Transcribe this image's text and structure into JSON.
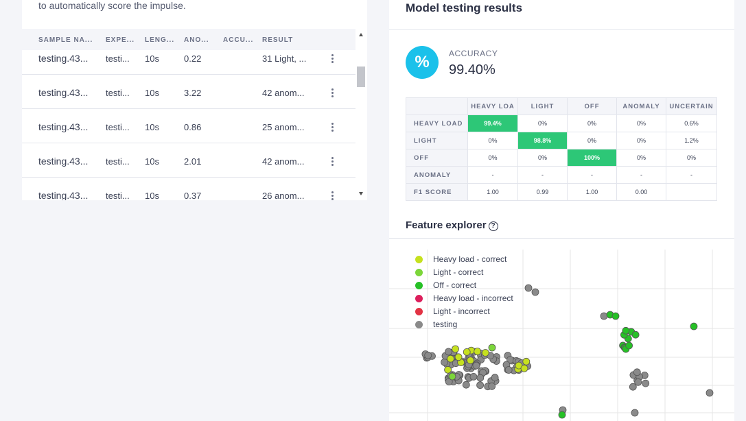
{
  "intro_text": "to automatically score the impulse.",
  "table": {
    "columns": [
      "SAMPLE NA...",
      "EXPE...",
      "LENG...",
      "ANO...",
      "ACCU...",
      "RESULT"
    ],
    "rows": [
      {
        "name": "testing.43...",
        "expected": "testi...",
        "length": "10s",
        "anomaly": "0.22",
        "accuracy": "",
        "result": "31 Light, ..."
      },
      {
        "name": "testing.43...",
        "expected": "testi...",
        "length": "10s",
        "anomaly": "3.22",
        "accuracy": "",
        "result": "42 anom..."
      },
      {
        "name": "testing.43...",
        "expected": "testi...",
        "length": "10s",
        "anomaly": "0.86",
        "accuracy": "",
        "result": "25 anom..."
      },
      {
        "name": "testing.43...",
        "expected": "testi...",
        "length": "10s",
        "anomaly": "2.01",
        "accuracy": "",
        "result": "42 anom..."
      },
      {
        "name": "testing.43...",
        "expected": "testi...",
        "length": "10s",
        "anomaly": "0.37",
        "accuracy": "",
        "result": "26 anom..."
      }
    ]
  },
  "results": {
    "title": "Model testing results",
    "accuracy_icon": "percent-icon",
    "accuracy_label": "ACCURACY",
    "accuracy_value": "99.40%",
    "matrix": {
      "columns": [
        "HEAVY LOA",
        "LIGHT",
        "OFF",
        "ANOMALY",
        "UNCERTAIN"
      ],
      "rows": [
        {
          "label": "HEAVY LOAD",
          "cells": [
            "99.4%",
            "0%",
            "0%",
            "0%",
            "0.6%"
          ],
          "highlight": 0
        },
        {
          "label": "LIGHT",
          "cells": [
            "0%",
            "98.8%",
            "0%",
            "0%",
            "1.2%"
          ],
          "highlight": 1
        },
        {
          "label": "OFF",
          "cells": [
            "0%",
            "0%",
            "100%",
            "0%",
            "0%"
          ],
          "highlight": 2
        },
        {
          "label": "ANOMALY",
          "cells": [
            "-",
            "-",
            "-",
            "-",
            "-"
          ],
          "highlight": -1
        },
        {
          "label": "F1 SCORE",
          "cells": [
            "1.00",
            "0.99",
            "1.00",
            "0.00",
            ""
          ],
          "highlight": -1
        }
      ],
      "highlight_color": "#2dc777"
    }
  },
  "feature_explorer": {
    "title": "Feature explorer",
    "help_icon": "question-circle-icon",
    "legend": [
      {
        "label": "Heavy load - correct",
        "color": "#c6e11f"
      },
      {
        "label": "Light - correct",
        "color": "#7cd63a"
      },
      {
        "label": "Off - correct",
        "color": "#26c026"
      },
      {
        "label": "Heavy load - incorrect",
        "color": "#dc1f5c"
      },
      {
        "label": "Light - incorrect",
        "color": "#e23344"
      },
      {
        "label": "testing",
        "color": "#8a8a8a"
      }
    ]
  }
}
